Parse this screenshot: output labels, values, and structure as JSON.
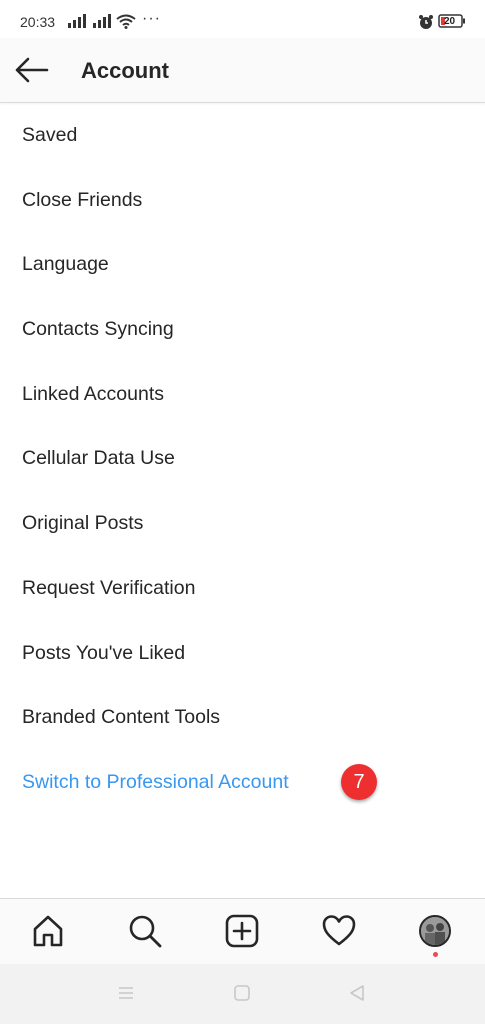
{
  "status_bar": {
    "time": "20:33",
    "overflow": "···",
    "battery": "20"
  },
  "header": {
    "title": "Account"
  },
  "menu": {
    "items": [
      {
        "label": "Saved"
      },
      {
        "label": "Close Friends"
      },
      {
        "label": "Language"
      },
      {
        "label": "Contacts Syncing"
      },
      {
        "label": "Linked Accounts"
      },
      {
        "label": "Cellular Data Use"
      },
      {
        "label": "Original Posts"
      },
      {
        "label": "Request Verification"
      },
      {
        "label": "Posts You've Liked"
      },
      {
        "label": "Branded Content Tools"
      }
    ],
    "professional": {
      "label": "Switch to Professional Account",
      "badge": "7"
    }
  },
  "colors": {
    "link": "#3897f0",
    "badge": "#ed2f2f",
    "activity_dot": "#ed4956"
  },
  "icons": {
    "bottom_nav": [
      "home-icon",
      "search-icon",
      "add-post-icon",
      "heart-icon",
      "profile-avatar"
    ],
    "system_nav": [
      "menu-icon",
      "home-square-icon",
      "back-triangle-icon"
    ]
  }
}
